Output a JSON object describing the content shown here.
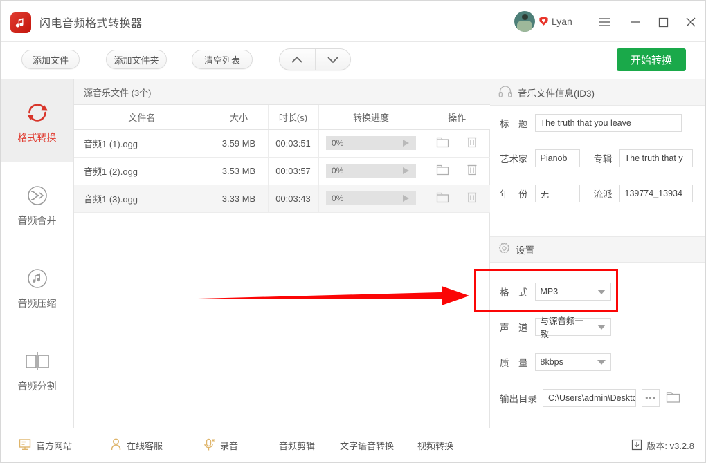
{
  "window": {
    "app_title": "闪电音频格式转换器",
    "username": "Lyan",
    "logo_icon": "music-note-icon",
    "avatar_icon": "user-avatar",
    "heart_badge_icon": "heart-badge-icon",
    "menu_icon": "hamburger-menu-icon",
    "minimize_icon": "minimize-icon",
    "maximize_icon": "maximize-icon",
    "close_icon": "close-icon"
  },
  "toolbar": {
    "add_file": "添加文件",
    "add_folder": "添加文件夹",
    "clear_list": "清空列表",
    "move_up_icon": "chevron-up-icon",
    "move_down_icon": "chevron-down-icon",
    "start_convert": "开始转换",
    "start_convert_color": "#1aa94a"
  },
  "sidebar": {
    "active_color": "#e03a2f",
    "items": [
      {
        "label": "格式转换",
        "icon": "refresh-circle-icon",
        "active": true
      },
      {
        "label": "音频合并",
        "icon": "merge-arrow-circle-icon",
        "active": false
      },
      {
        "label": "音频压缩",
        "icon": "music-note-circle-icon",
        "active": false
      },
      {
        "label": "音频分割",
        "icon": "split-squares-icon",
        "active": false
      }
    ]
  },
  "filelist": {
    "header": "源音乐文件 (3个)",
    "columns": [
      "文件名",
      "大小",
      "时长(s)",
      "转换进度",
      "操作"
    ],
    "rows": [
      {
        "name": "音频1 (1).ogg",
        "size": "3.59 MB",
        "duration": "00:03:51",
        "progress": "0%",
        "open_folder_icon": "folder-icon",
        "delete_icon": "trash-icon"
      },
      {
        "name": "音频1 (2).ogg",
        "size": "3.53 MB",
        "duration": "00:03:57",
        "progress": "0%",
        "open_folder_icon": "folder-icon",
        "delete_icon": "trash-icon"
      },
      {
        "name": "音频1 (3).ogg",
        "size": "3.33 MB",
        "duration": "00:03:43",
        "progress": "0%",
        "open_folder_icon": "folder-icon",
        "delete_icon": "trash-icon"
      }
    ]
  },
  "id3": {
    "panel_title": "音乐文件信息(ID3)",
    "panel_icon": "headphones-icon",
    "title_label": "标　题",
    "title_value": "The truth that you leave",
    "artist_label": "艺术家",
    "artist_value": "Pianob",
    "album_label": "专辑",
    "album_value": "The truth that y",
    "year_label": "年　份",
    "year_value": "无",
    "genre_label": "流派",
    "genre_value": "139774_13934"
  },
  "settings": {
    "panel_title": "设置",
    "panel_icon": "gear-icon",
    "format_label": "格　式",
    "format_value": "MP3",
    "channel_label": "声　道",
    "channel_value": "与源音频一致",
    "quality_label": "质　量",
    "quality_value": "8kbps",
    "output_label": "输出目录",
    "output_value": "C:\\Users\\admin\\Desktc",
    "browse_dots": "•••",
    "open_folder_icon": "folder-icon"
  },
  "annotation": {
    "highlight_color": "#fb0606",
    "arrow_icon": "red-arrow-pointing-right",
    "target": "格式"
  },
  "bottombar": {
    "items": [
      {
        "label": "官方网站",
        "icon": "monitor-icon"
      },
      {
        "label": "在线客服",
        "icon": "person-icon"
      },
      {
        "label": "录音",
        "icon": "microphone-icon"
      },
      {
        "label": "音频剪辑",
        "icon": ""
      },
      {
        "label": "文字语音转换",
        "icon": ""
      },
      {
        "label": "视频转换",
        "icon": ""
      }
    ],
    "version_label": "版本: v3.2.8",
    "version_icon": "download-icon"
  }
}
